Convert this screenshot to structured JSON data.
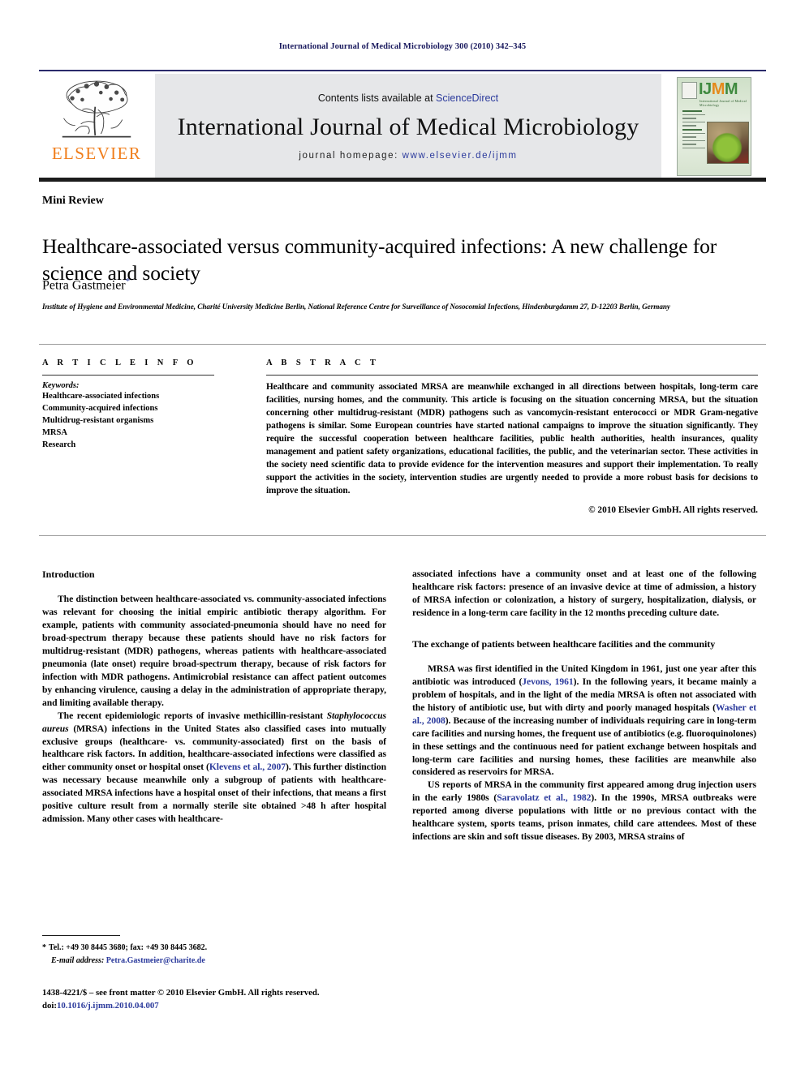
{
  "running_head": "International Journal of Medical Microbiology 300 (2010) 342–345",
  "masthead": {
    "publisher_logo_text": "ELSEVIER",
    "contents_prefix": "Contents lists available at",
    "contents_link": "ScienceDirect",
    "journal_title": "International Journal of Medical Microbiology",
    "homepage_label": "journal homepage:",
    "homepage_url": "www.elsevier.de/ijmm",
    "cover": {
      "acronym_part1": "IJ",
      "acronym_part2": "M",
      "acronym_part3": "M",
      "subtitle": "International Journal of Medical Microbiology"
    }
  },
  "article": {
    "type": "Mini Review",
    "title": "Healthcare-associated versus community-acquired infections: A new challenge for science and society",
    "author": "Petra Gastmeier",
    "author_marker": "*",
    "affiliation": "Institute of Hygiene and Environmental Medicine, Charité University Medicine Berlin, National Reference Centre for Surveillance of Nosocomial Infections, Hindenburgdamm 27, D-12203 Berlin, Germany"
  },
  "info": {
    "heading": "A R T I C L E   I N F O",
    "keywords_label": "Keywords:",
    "keywords": [
      "Healthcare-associated infections",
      "Community-acquired infections",
      "Multidrug-resistant organisms",
      "MRSA",
      "Research"
    ]
  },
  "abstract": {
    "heading": "A B S T R A C T",
    "text": "Healthcare and community associated MRSA are meanwhile exchanged in all directions between hospitals, long-term care facilities, nursing homes, and the community. This article is focusing on the situation concerning MRSA, but the situation concerning other multidrug-resistant (MDR) pathogens such as vancomycin-resistant enterococci or MDR Gram-negative pathogens is similar. Some European countries have started national campaigns to improve the situation significantly. They require the successful cooperation between healthcare facilities, public health authorities, health insurances, quality management and patient safety organizations, educational facilities, the public, and the veterinarian sector. These activities in the society need scientific data to provide evidence for the intervention measures and support their implementation. To really support the activities in the society, intervention studies are urgently needed to provide a more robust basis for decisions to improve the situation.",
    "copyright": "© 2010 Elsevier GmbH. All rights reserved."
  },
  "body": {
    "left": {
      "intro_heading": "Introduction",
      "para1": "The distinction between healthcare-associated vs. community-associated infections was relevant for choosing the initial empiric antibiotic therapy algorithm. For example, patients with community associated-pneumonia should have no need for broad-spectrum therapy because these patients should have no risk factors for multidrug-resistant (MDR) pathogens, whereas patients with healthcare-associated pneumonia (late onset) require broad-spectrum therapy, because of risk factors for infection with MDR pathogens. Antimicrobial resistance can affect patient outcomes by enhancing virulence, causing a delay in the administration of appropriate therapy, and limiting available therapy.",
      "para2_a": "The recent epidemiologic reports of invasive methicillin-resistant ",
      "para2_italic": "Staphylococcus aureus",
      "para2_b": " (MRSA) infections in the United States also classified cases into mutually exclusive groups (healthcare- vs. community-associated) first on the basis of healthcare risk factors. In addition, healthcare-associated infections were classified as either community onset or hospital onset (",
      "para2_ref": "Klevens et al., 2007",
      "para2_c": "). This further distinction was necessary because meanwhile only a subgroup of patients with healthcare-associated MRSA infections have a hospital onset of their infections, that means a first positive culture result from a normally sterile site obtained >48 h after hospital admission. Many other cases with healthcare-"
    },
    "right": {
      "para_cont": "associated infections have a community onset and at least one of the following healthcare risk factors: presence of an invasive device at time of admission, a history of MRSA infection or colonization, a history of surgery, hospitalization, dialysis, or residence in a long-term care facility in the 12 months preceding culture date.",
      "heading2": "The exchange of patients between healthcare facilities and the community",
      "para3_a": "MRSA was first identified in the United Kingdom in 1961, just one year after this antibiotic was introduced (",
      "para3_ref1": "Jevons, 1961",
      "para3_b": "). In the following years, it became mainly a problem of hospitals, and in the light of the media MRSA is often not associated with the history of antibiotic use, but with dirty and poorly managed hospitals (",
      "para3_ref2": "Washer et al., 2008",
      "para3_c": "). Because of the increasing number of individuals requiring care in long-term care facilities and nursing homes, the frequent use of antibiotics (e.g. fluoroquinolones) in these settings and the continuous need for patient exchange between hospitals and long-term care facilities and nursing homes, these facilities are meanwhile also considered as reservoirs for MRSA.",
      "para4_a": "US reports of MRSA in the community first appeared among drug injection users in the early 1980s (",
      "para4_ref": "Saravolatz et al., 1982",
      "para4_b": "). In the 1990s, MRSA outbreaks were reported among diverse populations with little or no previous contact with the healthcare system, sports teams, prison inmates, child care attendees. Most of these infections are skin and soft tissue diseases. By 2003, MRSA strains of"
    }
  },
  "footnotes": {
    "marker": "*",
    "contact": "Tel.: +49 30 8445 3680; fax: +49 30 8445 3682.",
    "email_label": "E-mail address:",
    "email": "Petra.Gastmeier@charite.de",
    "issn_line": "1438-4221/$ – see front matter © 2010 Elsevier GmbH. All rights reserved.",
    "doi_label": "doi:",
    "doi": "10.1016/j.ijmm.2010.04.007"
  },
  "colors": {
    "link": "#2b3a9c",
    "runhead": "#1a1a5e",
    "elsevier_orange": "#f07d1a",
    "masthead_band": "#e6e7e9"
  }
}
